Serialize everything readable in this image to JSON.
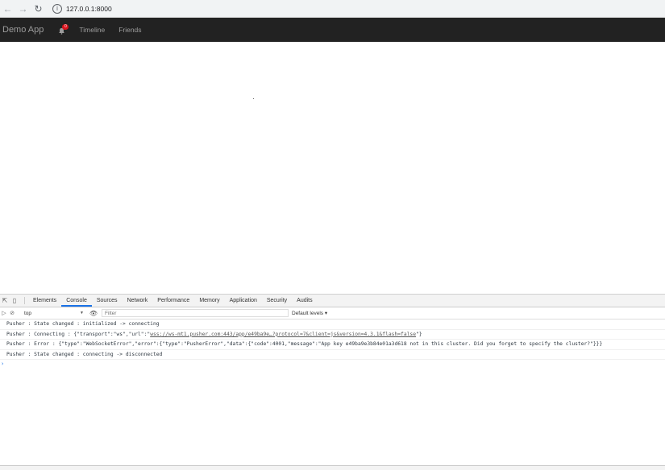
{
  "browser": {
    "back_icon": "arrow-left-icon",
    "forward_icon": "arrow-right-icon",
    "reload_icon": "reload-icon",
    "info_icon": "info-icon",
    "url": "127.0.0.1:8000"
  },
  "navbar": {
    "brand": "Demo App",
    "notification_count": "0",
    "links": [
      "Timeline",
      "Friends"
    ]
  },
  "devtools": {
    "tabs": [
      "Elements",
      "Console",
      "Sources",
      "Network",
      "Performance",
      "Memory",
      "Application",
      "Security",
      "Audits"
    ],
    "active_tab": "Console",
    "context": "top",
    "filter_placeholder": "Filter",
    "levels": "Default levels ▾",
    "console_lines": [
      {
        "text": "Pusher : State changed : initialized -> connecting"
      },
      {
        "pre": "Pusher : Connecting : {\"transport\":\"ws\",\"url\":\"",
        "link": "wss://ws-mt1.pusher.com:443/app/e49ba9e…?protocol=7&client=js&version=4.3.1&flash=false",
        "post": "\"}"
      },
      {
        "text": "Pusher : Error : {\"type\":\"WebSocketError\",\"error\":{\"type\":\"PusherError\",\"data\":{\"code\":4001,\"message\":\"App key e49ba9e3b84e01a3d618 not in this cluster. Did you forget to specify the cluster?\"}}}"
      },
      {
        "text": "Pusher : State changed : connecting -> disconnected"
      }
    ],
    "prompt": "›"
  }
}
